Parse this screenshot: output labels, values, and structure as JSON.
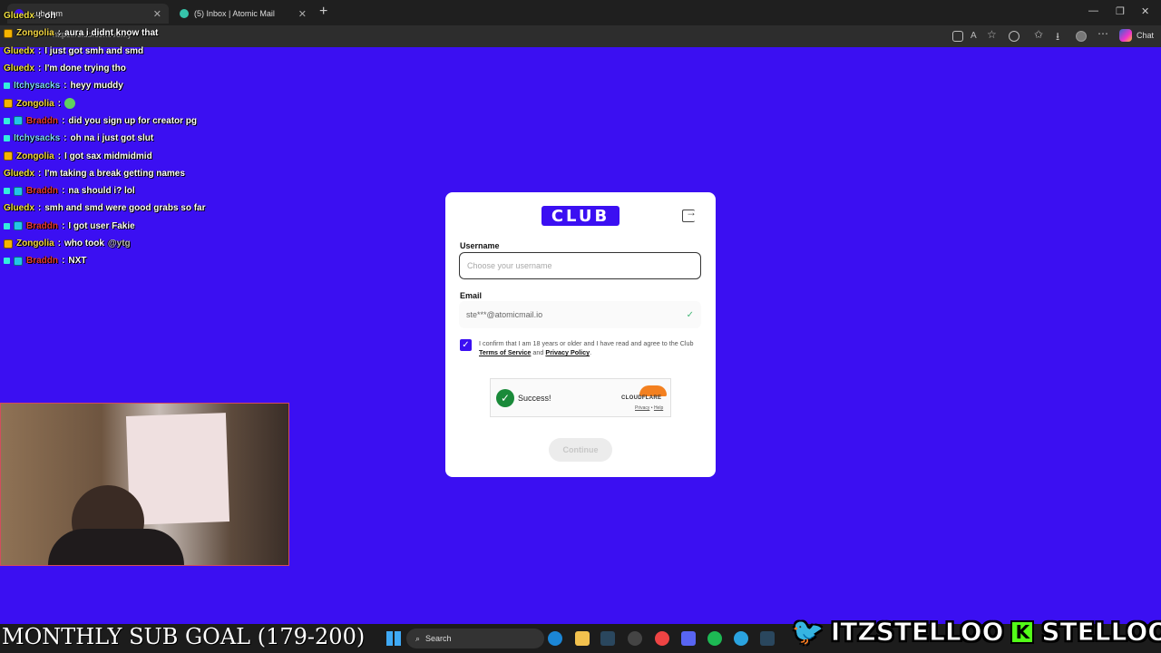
{
  "browser": {
    "tabs": [
      {
        "label": "...ub.com",
        "active": true
      },
      {
        "label": "(5) Inbox | Atomic Mail",
        "active": false
      }
    ],
    "url": "https://club.com/verify",
    "chat_button": "Chat"
  },
  "chat": [
    {
      "user": "Gluedx",
      "color": "#f0e040",
      "badges": [],
      "text": "oh"
    },
    {
      "user": "Zongolia",
      "color": "#f5d742",
      "badges": [
        "crown"
      ],
      "text": "aura i didnt know that"
    },
    {
      "user": "Gluedx",
      "color": "#f0e040",
      "badges": [],
      "text": "I just got smh and smd"
    },
    {
      "user": "Gluedx",
      "color": "#f0e040",
      "badges": [],
      "text": "I'm done trying tho"
    },
    {
      "user": "Itchysacks",
      "color": "#7dd8ff",
      "badges": [
        "mini"
      ],
      "text": "heyy muddy"
    },
    {
      "user": "Zongolia",
      "color": "#f5d742",
      "badges": [
        "crown"
      ],
      "text": "",
      "emote": true
    },
    {
      "user": "Braddn",
      "color": "#e53935",
      "badges": [
        "mini",
        "sq"
      ],
      "text": "did you sign up for creator pg"
    },
    {
      "user": "Itchysacks",
      "color": "#7dd8ff",
      "badges": [
        "mini"
      ],
      "text": "oh na i just got slut"
    },
    {
      "user": "Zongolia",
      "color": "#f5d742",
      "badges": [
        "crown"
      ],
      "text": "I got sax midmidmid"
    },
    {
      "user": "Gluedx",
      "color": "#f0e040",
      "badges": [],
      "text": "I'm taking a break getting names"
    },
    {
      "user": "Braddn",
      "color": "#e53935",
      "badges": [
        "mini",
        "sq"
      ],
      "text": "na should i? lol"
    },
    {
      "user": "Gluedx",
      "color": "#f0e040",
      "badges": [],
      "text": "smh and smd were good grabs so far"
    },
    {
      "user": "Braddn",
      "color": "#e53935",
      "badges": [
        "mini",
        "sq"
      ],
      "text": "I got user Fakie"
    },
    {
      "user": "Zongolia",
      "color": "#f5d742",
      "badges": [
        "crown"
      ],
      "text": "who took",
      "mention": "@ytg"
    },
    {
      "user": "Braddn",
      "color": "#e53935",
      "badges": [
        "mini",
        "sq"
      ],
      "text": "NXT"
    }
  ],
  "modal": {
    "logo": "CLUB",
    "username_label": "Username",
    "username_placeholder": "Choose your username",
    "email_label": "Email",
    "email_value": "ste***@atomicmail.io",
    "consent_prefix": "I confirm that I am 18 years or older and I have read and agree to the Club ",
    "terms_link": "Terms of Service",
    "consent_and": " and ",
    "privacy_link": "Privacy Policy",
    "consent_suffix": ".",
    "captcha_status": "Success!",
    "captcha_brand": "CLOUDFLARE",
    "captcha_privacy": "Privacy",
    "captcha_help": "Help",
    "continue_label": "Continue"
  },
  "taskbar": {
    "search_placeholder": "Search"
  },
  "overlay": {
    "goal_text": "MONTHLY SUB GOAL (179-200)",
    "twitter_handle": "ITZSTELLOO",
    "kick_handle": "STELLOOO"
  },
  "colors": {
    "background": "#3b0ff2",
    "brand": "#3b0ff2",
    "success": "#1a8a3a",
    "cloudflare": "#f38020",
    "kick": "#53fc18"
  }
}
